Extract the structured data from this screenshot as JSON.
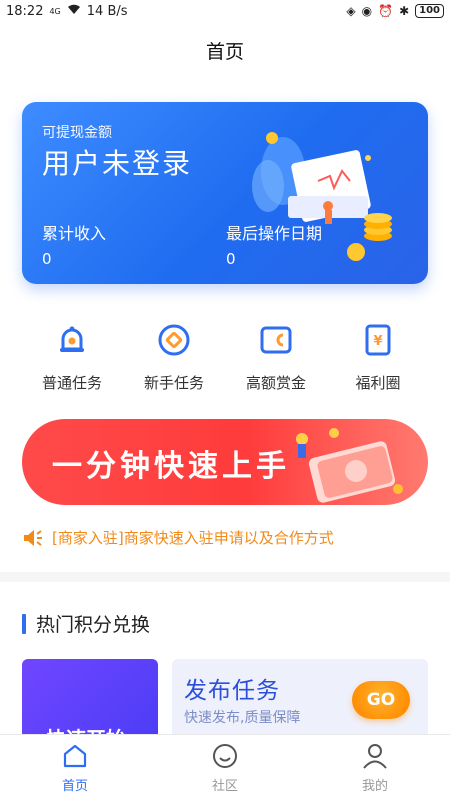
{
  "status_bar": {
    "time": "18:22",
    "network": "4G",
    "speed": "14 B/s",
    "battery": "100"
  },
  "header": {
    "title": "首页"
  },
  "earn_card": {
    "withdraw_label": "可提现金额",
    "withdraw_value": "用户未登录",
    "total_label": "累计收入",
    "total_value": "0",
    "last_label": "最后操作日期",
    "last_value": "0"
  },
  "features": [
    {
      "label": "普通任务",
      "icon": "bell-icon"
    },
    {
      "label": "新手任务",
      "icon": "target-icon"
    },
    {
      "label": "高额赏金",
      "icon": "wallet-icon"
    },
    {
      "label": "福利圈",
      "icon": "yuan-tag-icon"
    }
  ],
  "banner": {
    "text": "一分钟快速上手"
  },
  "notice": {
    "text": "[商家入驻]商家快速入驻申请以及合作方式"
  },
  "hot": {
    "title": "热门积分兑换",
    "left_card": {
      "label": "快速开始"
    },
    "right_card": {
      "title": "发布任务",
      "subtitle": "快速发布,质量保障",
      "badge": "GO"
    }
  },
  "bottom_nav": [
    {
      "label": "首页",
      "active": true
    },
    {
      "label": "社区",
      "active": false
    },
    {
      "label": "我的",
      "active": false
    }
  ],
  "colors": {
    "primary": "#2f6ef0",
    "banner_red": "#ff3b3b",
    "notice_orange": "#f08a1a"
  }
}
